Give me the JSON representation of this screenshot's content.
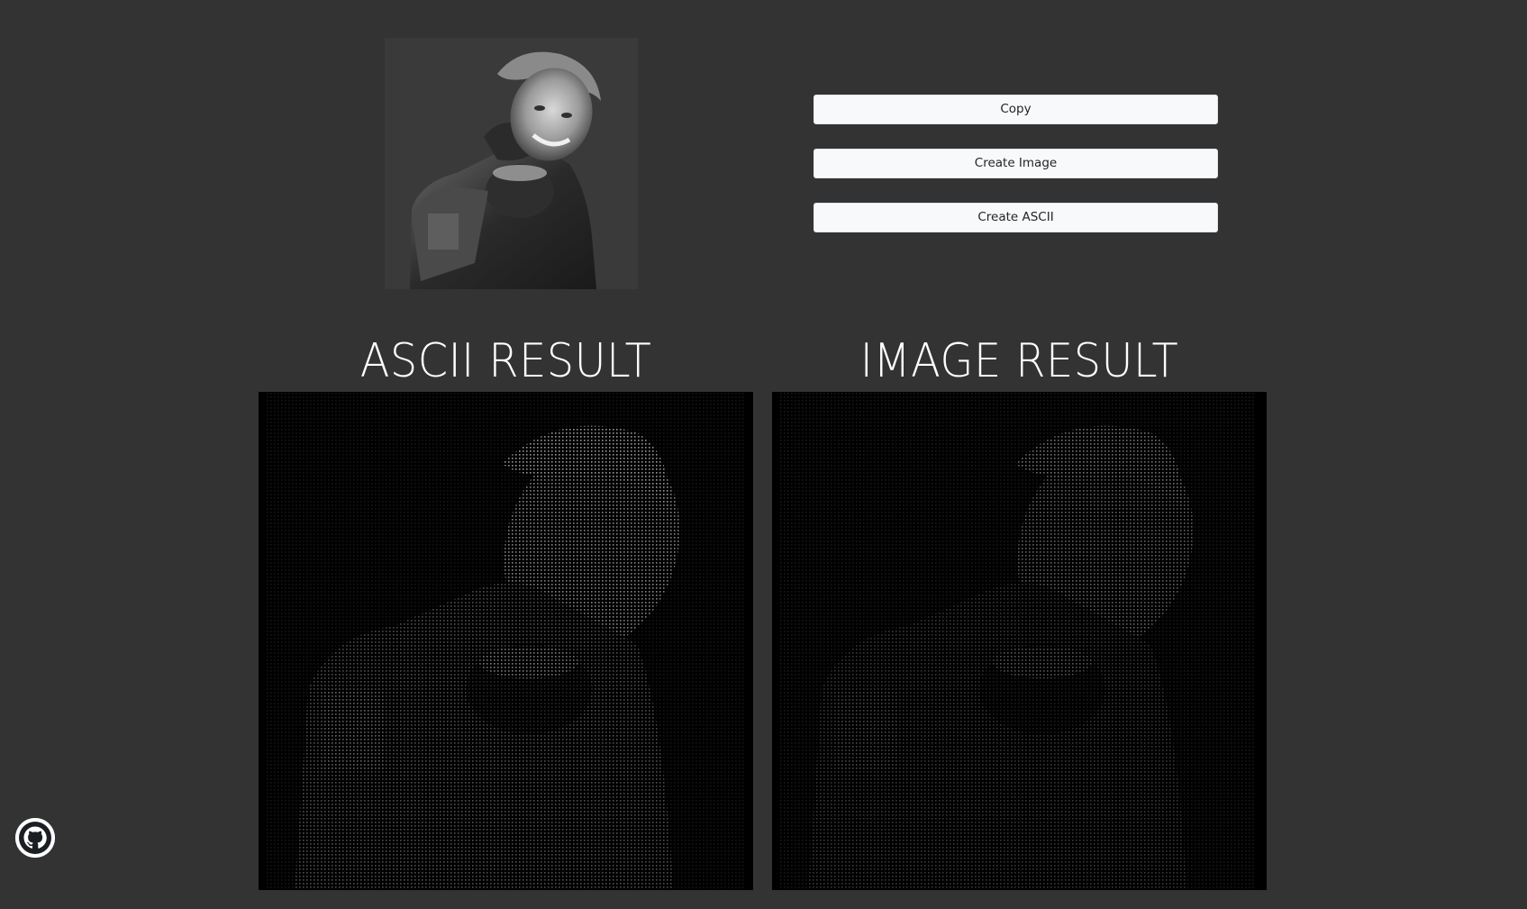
{
  "toolbar": {
    "copy_label": "Copy",
    "create_image_label": "Create Image",
    "create_ascii_label": "Create ASCII"
  },
  "results": {
    "ascii_title": "ASCII RESULT",
    "image_title": "IMAGE RESULT"
  },
  "icons": {
    "github": "github-icon"
  },
  "colors": {
    "background": "#333333",
    "button_bg": "#f8f9fa",
    "button_text": "#212529",
    "title_text": "#ffffff",
    "panel_bg": "#000000"
  }
}
